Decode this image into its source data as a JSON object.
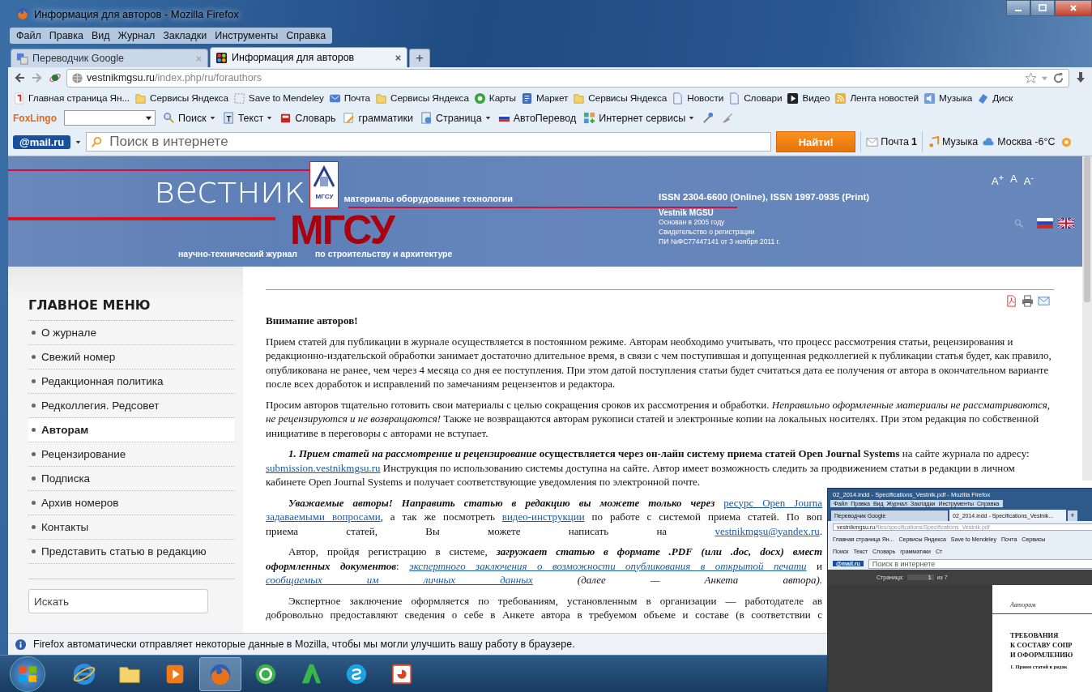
{
  "window": {
    "title": "Информация для авторов - Mozilla Firefox"
  },
  "menu": [
    "Файл",
    "Правка",
    "Вид",
    "Журнал",
    "Закладки",
    "Инструменты",
    "Справка"
  ],
  "tabs": [
    {
      "label": "Переводчик Google",
      "selected": false,
      "kind": "translate"
    },
    {
      "label": "Информация для авторов",
      "selected": true,
      "kind": "joomla"
    }
  ],
  "new_tab": "+",
  "address": {
    "host": "vestnikmgsu.ru",
    "path": "/index.php/ru/forauthors"
  },
  "bookmarks": [
    {
      "label": "Главная страница Ян...",
      "kind": "yandex"
    },
    {
      "label": "Сервисы Яндекса",
      "kind": "folder"
    },
    {
      "label": "Save to Mendeley",
      "kind": "dashed"
    },
    {
      "label": "Почта",
      "kind": "mail"
    },
    {
      "label": "Сервисы Яндекса",
      "kind": "folder"
    },
    {
      "label": "Карты",
      "kind": "maps"
    },
    {
      "label": "Маркет",
      "kind": "market"
    },
    {
      "label": "Сервисы Яндекса",
      "kind": "folder"
    },
    {
      "label": "Новости",
      "kind": "doc"
    },
    {
      "label": "Словари",
      "kind": "doc"
    },
    {
      "label": "Видео",
      "kind": "video"
    },
    {
      "label": "Лента новостей",
      "kind": "rss"
    },
    {
      "label": "Музыка",
      "kind": "speaker"
    },
    {
      "label": "Диск",
      "kind": "disk"
    }
  ],
  "foxlingo": {
    "logo": "FoxLingo",
    "items": [
      {
        "label": "Поиск",
        "kind": "search",
        "dropdown": true
      },
      {
        "label": "Текст",
        "kind": "text",
        "dropdown": true
      },
      {
        "label": "Словарь",
        "kind": "book",
        "dropdown": false
      },
      {
        "label": "грамматики",
        "kind": "pencil",
        "dropdown": false
      },
      {
        "label": "Страница",
        "kind": "page",
        "dropdown": true
      },
      {
        "label": "АвтоПеревод",
        "kind": "flag",
        "dropdown": false
      },
      {
        "label": "Интернет сервисы",
        "kind": "grid",
        "dropdown": true
      }
    ]
  },
  "mailru": {
    "logo": "@mail.ru",
    "placeholder": "Поиск в интернете",
    "button": "Найти!",
    "mail": "Почта",
    "mail_count": "1",
    "music": "Музыка",
    "weather": "Москва -6°C"
  },
  "site_header": {
    "wordmark": "вестник",
    "wordmark_red": "МГСУ",
    "emblem_text": "МГСУ",
    "tagline": "материалы оборудование технологии",
    "subtitle_left": "научно-технический журнал",
    "subtitle_right": "по строительству и архитектуре",
    "issn": "ISSN 2304-6600 (Online), ISSN 1997-0935 (Print)",
    "journal": "Vestnik MGSU",
    "founded": "Основан в 2005 году",
    "certificate": "Свидетельство о регистрации",
    "certificate_no": "ПИ №ФС77447141 от 3 ноября 2011 г.",
    "font_sizes": [
      "A$^{+}$",
      "A",
      "A$^{-}$"
    ]
  },
  "sidebar": {
    "title": "ГЛАВНОЕ МЕНЮ",
    "items": [
      {
        "label": "О журнале",
        "selected": false
      },
      {
        "label": "Свежий номер",
        "selected": false
      },
      {
        "label": "Редакционная политика",
        "selected": false
      },
      {
        "label": "Редколлегия. Редсовет",
        "selected": false
      },
      {
        "label": "Авторам",
        "selected": true
      },
      {
        "label": "Рецензирование",
        "selected": false
      },
      {
        "label": "Подписка",
        "selected": false
      },
      {
        "label": "Архив номеров",
        "selected": false
      },
      {
        "label": "Контакты",
        "selected": false
      },
      {
        "label": "Представить статью в редакцию",
        "selected": false
      }
    ],
    "search_placeholder": "Искать"
  },
  "article": {
    "heading": "Внимание авторов!",
    "paragraphs": [
      {
        "kind": "flow",
        "indent": false,
        "segments": [
          {
            "kind": "text",
            "text": "Прием статей для публикации в журнале осуществляется в постоянном режиме. Авторам необходимо учитывать, что процесс рассмотрения статьи, рецензирования и редакционно-издательской обработки занимает достаточно длительное время, в связи с чем поступившая и допущенная редколлегией к публикации статья будет, как правило, опубликована не ранее, чем через  4 месяца со дня ее поступления. При этом датой поступления статьи будет считаться дата ее получения от автора в окончательном варианте  после всех доработок и исправлений по замечаниям рецензентов и редактора."
          }
        ]
      },
      {
        "kind": "flow",
        "indent": false,
        "segments": [
          {
            "kind": "text",
            "text": "Просим авторов тщательно готовить свои материалы с целью сокращения сроков их рассмотрения и обработки. *Неправильно оформленные материалы не рассматриваются, не рецензируются и не возвращаются!* Также не возвращаются авторам рукописи статей и электронные копии на локальных носителях. При этом редакция по собственной инициативе в переговоры с авторами не вступает."
          }
        ]
      },
      {
        "kind": "flow",
        "indent": true,
        "segments": [
          {
            "kind": "emphasis",
            "text": "1. Прием статей на рассмотрение и рецензирование"
          },
          {
            "kind": "text",
            "text": " **осуществляется через он-лайн систему приема статей Open Journal Systems** на сайте журнала по адресу: "
          },
          {
            "kind": "link",
            "text": "submission.vestnikmgsu.ru"
          },
          {
            "kind": "text",
            "text": " Инструкция по использованию системы доступна на сайте. Автор имеет возможность следить за продвижением статьи в редакции в личном кабинете Open Journal Systems и получает соответствующие уведомления по электронной почте."
          }
        ]
      },
      {
        "kind": "lines",
        "indent": true,
        "lines": [
          [
            {
              "kind": "emphasis",
              "text": "Уважаемые авторы! Направить статью в редакцию вы можете только через "
            },
            {
              "kind": "link",
              "text": "ресурс  Open Journa"
            }
          ],
          [
            {
              "kind": "link",
              "text": "задаваемыми вопросами"
            },
            {
              "kind": "text",
              "text": ", а так же посмотреть "
            },
            {
              "kind": "link",
              "text": "видео-инструкции"
            },
            {
              "kind": "text",
              "text": " по работе с системой приема статей. По воп"
            }
          ],
          [
            {
              "kind": "text",
              "text": "приема статей, Вы можете написать на "
            },
            {
              "kind": "link",
              "text": "vestnikmgsu@yandex.ru"
            },
            {
              "kind": "text",
              "text": "."
            }
          ]
        ]
      },
      {
        "kind": "lines",
        "indent": true,
        "lines": [
          [
            {
              "kind": "text",
              "text": "Автор, пройдя регистрацию в системе, "
            },
            {
              "kind": "emphasis",
              "text": "загружает статью в формате .PDF (или .doc, docx) вмест"
            }
          ],
          [
            {
              "kind": "emphasis",
              "text": "оформленных документов"
            },
            {
              "kind": "text",
              "text": ": "
            },
            {
              "kind": "link",
              "text": "*экспертного заключения о возможности опубликования в открытой печати*"
            },
            {
              "kind": "text",
              "text": " и"
            }
          ],
          [
            {
              "kind": "link",
              "text": "*сообщаемых им личных данных*"
            },
            {
              "kind": "text",
              "text": " *(далее — Анкета автора).*"
            }
          ]
        ]
      },
      {
        "kind": "lines",
        "indent": true,
        "lines": [
          [
            {
              "kind": "text",
              "text": "Экспертное заключение оформляется по требованиям, установленным в организации — работодателе ав"
            }
          ],
          [
            {
              "kind": "text",
              "text": "добровольно предоставляют сведения о себе в Анкете автора в требуемом объеме и составе (в соответствии с"
            }
          ]
        ]
      }
    ]
  },
  "status_bar": "Firefox автоматически отправляет некоторые данные в Mozilla, чтобы мы могли улучшить вашу работу в браузере.",
  "taskbar": [
    {
      "kind": "ie",
      "active": false
    },
    {
      "kind": "folder",
      "active": false
    },
    {
      "kind": "media",
      "active": false
    },
    {
      "kind": "firefox",
      "active": true
    },
    {
      "kind": "agent",
      "active": false
    },
    {
      "kind": "green-a",
      "active": false
    },
    {
      "kind": "skype",
      "active": false
    },
    {
      "kind": "presentation",
      "active": false
    }
  ],
  "preview_window": {
    "title": "02_2014.indd - Specifications_Vestnik.pdf - Mozilla Firefox",
    "menu": [
      "Файл",
      "Правка",
      "Вид",
      "Журнал",
      "Закладки",
      "Инструменты",
      "Справка"
    ],
    "tabs": [
      {
        "label": "Переводчик Google",
        "selected": false
      },
      {
        "label": "02_2014.indd - Specifications_Vestnik...",
        "selected": true
      }
    ],
    "new_tab": "+",
    "address": {
      "host": "vestnikmgsu.ru",
      "path": "/files/specifications/Specifications_Vestnik.pdf"
    },
    "bookmarks": [
      "Главная страница Ян...",
      "Сервисы Яндекса",
      "Save to Mendeley",
      "Почта",
      "Сервисы"
    ],
    "foxlingo": [
      "Поиск",
      "Текст",
      "Словарь",
      "грамматики",
      "Ст"
    ],
    "mail_logo": "@mail.ru",
    "placeholder": "Поиск в интернете",
    "pdf": {
      "page_label": "Страница:",
      "page": "1",
      "of": "из 7",
      "running_head": "Авторам",
      "title_lines": [
        "ТРЕБОВАНИЯ",
        "К СОСТАВУ СОПР",
        "И ОФОРМЛЕНИЮ"
      ],
      "first_line": "1. Прием статей в редак"
    }
  }
}
